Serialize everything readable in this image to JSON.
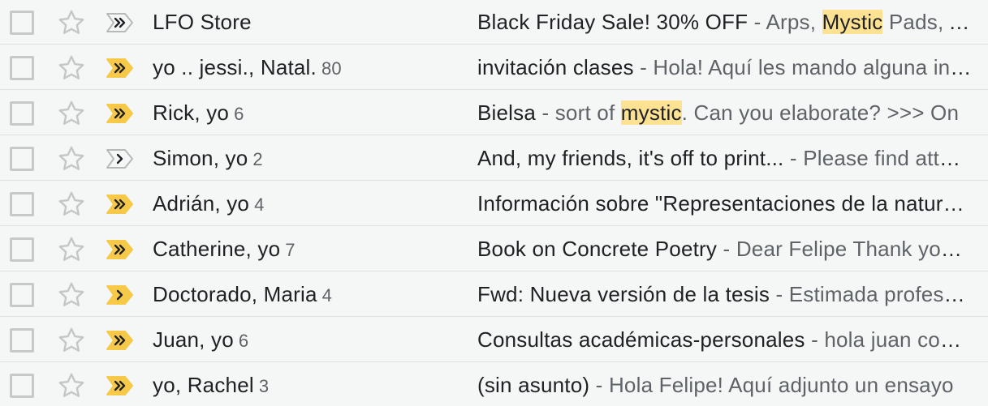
{
  "rows": [
    {
      "sender": "LFO Store",
      "count": "",
      "importance": "outline",
      "subject": "Black Friday Sale! 30% OFF",
      "snippet_pre": " - Arps, ",
      "snippet_hl": "Mystic",
      "snippet_post": " Pads, Analog Gear, Lead Synths"
    },
    {
      "sender": "yo .. jessi., Natal.",
      "count": "80",
      "importance": "filled",
      "subject": "invitación clases",
      "snippet_pre": " - Hola! Aquí les mando alguna información",
      "snippet_hl": "",
      "snippet_post": ""
    },
    {
      "sender": "Rick, yo",
      "count": "6",
      "importance": "filled",
      "subject": "Bielsa",
      "snippet_pre": " - sort of ",
      "snippet_hl": "mystic",
      "snippet_post": ". Can you elaborate? >>> On"
    },
    {
      "sender": "Simon, yo",
      "count": "2",
      "importance": "outline-single",
      "subject": "And, my friends, it's off to print...",
      "snippet_pre": " - Please find attached",
      "snippet_hl": "",
      "snippet_post": ""
    },
    {
      "sender": "Adrián, yo",
      "count": "4",
      "importance": "filled",
      "subject": "Información sobre \"Representaciones de la naturaleza\"",
      "snippet_pre": "",
      "snippet_hl": "",
      "snippet_post": ""
    },
    {
      "sender": "Catherine, yo",
      "count": "7",
      "importance": "filled",
      "subject": "Book on Concrete Poetry",
      "snippet_pre": " - Dear Felipe Thank you for",
      "snippet_hl": "",
      "snippet_post": ""
    },
    {
      "sender": "Doctorado, Maria",
      "count": "4",
      "importance": "filled-single",
      "subject": "Fwd: Nueva versión de la tesis",
      "snippet_pre": " - Estimada profesora",
      "snippet_hl": "",
      "snippet_post": ""
    },
    {
      "sender": "Juan, yo",
      "count": "6",
      "importance": "filled",
      "subject": "Consultas académicas-personales",
      "snippet_pre": " - hola juan como estas",
      "snippet_hl": "",
      "snippet_post": ""
    },
    {
      "sender": "yo, Rachel",
      "count": "3",
      "importance": "filled",
      "subject": "(sin asunto)",
      "snippet_pre": " - Hola Felipe! Aquí adjunto un ensayo",
      "snippet_hl": "",
      "snippet_post": ""
    }
  ],
  "colors": {
    "importance_fill": "#f7c948",
    "highlight": "#fde293",
    "row_bg": "#f5f7f7"
  },
  "icons": {
    "checkbox": "checkbox-icon",
    "star": "star-outline-icon",
    "importance": "importance-marker-icon"
  }
}
